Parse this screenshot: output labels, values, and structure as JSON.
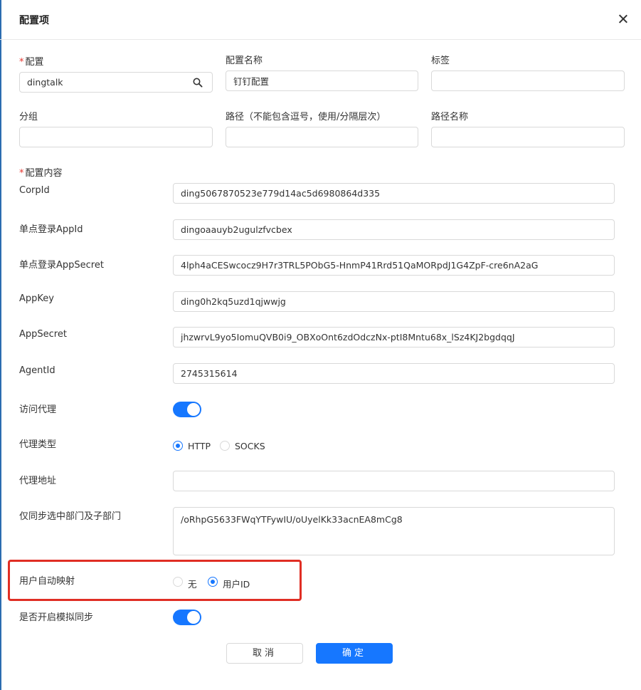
{
  "dialog": {
    "title": "配置项",
    "close_icon": "close-icon"
  },
  "top_fields": {
    "config": {
      "label": "配置",
      "required": "*",
      "value": "dingtalk",
      "search_icon": "search-icon"
    },
    "config_name": {
      "label": "配置名称",
      "value": "钉钉配置"
    },
    "tags": {
      "label": "标签",
      "value": ""
    },
    "group": {
      "label": "分组",
      "value": ""
    },
    "path": {
      "label": "路径（不能包含逗号，使用/分隔层次）",
      "value": ""
    },
    "path_name": {
      "label": "路径名称",
      "value": ""
    }
  },
  "content": {
    "label": "配置内容",
    "required": "*",
    "corp_id": {
      "label": "CorpId",
      "value": "ding5067870523e779d14ac5d6980864d335"
    },
    "sso_app_id": {
      "label": "单点登录AppId",
      "value": "dingoaauyb2ugulzfvcbex"
    },
    "sso_app_secret": {
      "label": "单点登录AppSecret",
      "value": "4lph4aCESwcocz9H7r3TRL5PObG5-HnmP41Rrd51QaMORpdJ1G4ZpF-cre6nA2aG"
    },
    "app_key": {
      "label": "AppKey",
      "value": "ding0h2kq5uzd1qjwwjg"
    },
    "app_secret": {
      "label": "AppSecret",
      "value": "jhzwrvL9yo5IomuQVB0i9_OBXoOnt6zdOdczNx-ptI8Mntu68x_lSz4KJ2bgdqqJ"
    },
    "agent_id": {
      "label": "AgentId",
      "value": "2745315614"
    },
    "proxy": {
      "label": "访问代理",
      "enabled": true
    },
    "proxy_type": {
      "label": "代理类型",
      "options": [
        "HTTP",
        "SOCKS"
      ],
      "selected": "HTTP"
    },
    "proxy_address": {
      "label": "代理地址",
      "value": ""
    },
    "sync_depts": {
      "label": "仅同步选中部门及子部门",
      "value": "/oRhpG5633FWqYTFywIU/oUyelKk33acnEA8mCg8"
    },
    "user_mapping": {
      "label": "用户自动映射",
      "options": [
        "无",
        "用户ID"
      ],
      "selected": "用户ID"
    },
    "simulate_sync": {
      "label": "是否开启模拟同步",
      "enabled": true
    }
  },
  "footer": {
    "cancel_label": "取消",
    "ok_label": "确定"
  },
  "colors": {
    "primary": "#1677ff",
    "highlight": "#e02e24",
    "required": "#e5332c"
  }
}
